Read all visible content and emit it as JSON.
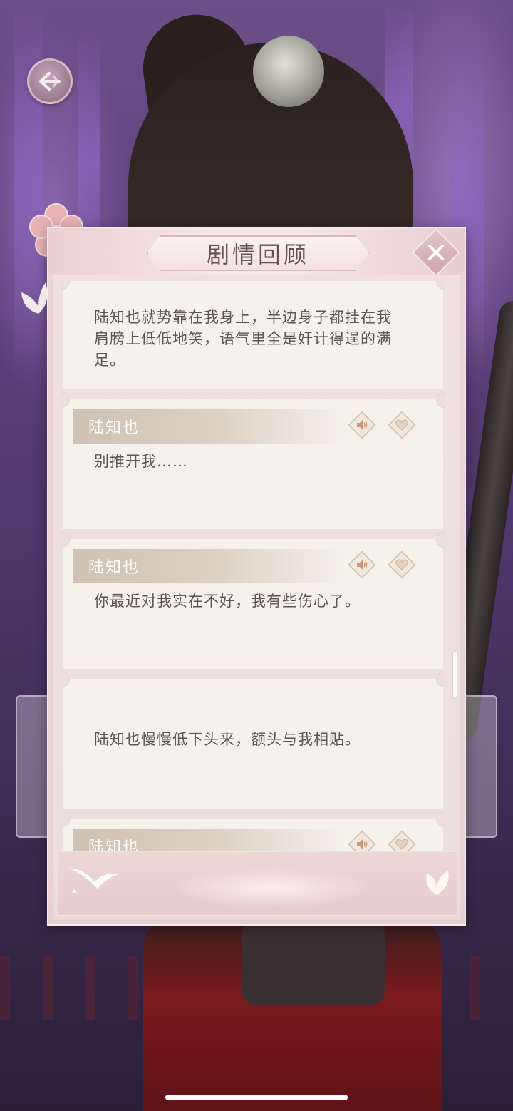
{
  "colors": {
    "accent": "#6a4e52",
    "card_bg": "#f5f2ec",
    "text": "#5d5455",
    "name_bar": "#cfc1b3"
  },
  "nav": {
    "back_icon": "back-arrow-icon"
  },
  "dialog": {
    "title": "剧情回顾",
    "close_icon": "close-icon"
  },
  "entries": [
    {
      "type": "narration",
      "text": "陆知也就势靠在我身上，半边身子都挂在我肩膀上低低地笑，语气里全是奸计得逞的满足。"
    },
    {
      "type": "dialogue",
      "speaker": "陆知也",
      "text": "别推开我……",
      "voice_icon": "speaker-icon",
      "like_icon": "heart-icon"
    },
    {
      "type": "dialogue",
      "speaker": "陆知也",
      "text": "你最近对我实在不好，我有些伤心了。",
      "voice_icon": "speaker-icon",
      "like_icon": "heart-icon"
    },
    {
      "type": "narration",
      "text": "陆知也慢慢低下头来，额头与我相贴。"
    },
    {
      "type": "dialogue",
      "speaker": "陆知也",
      "text": "",
      "voice_icon": "speaker-icon",
      "like_icon": "heart-icon"
    }
  ]
}
